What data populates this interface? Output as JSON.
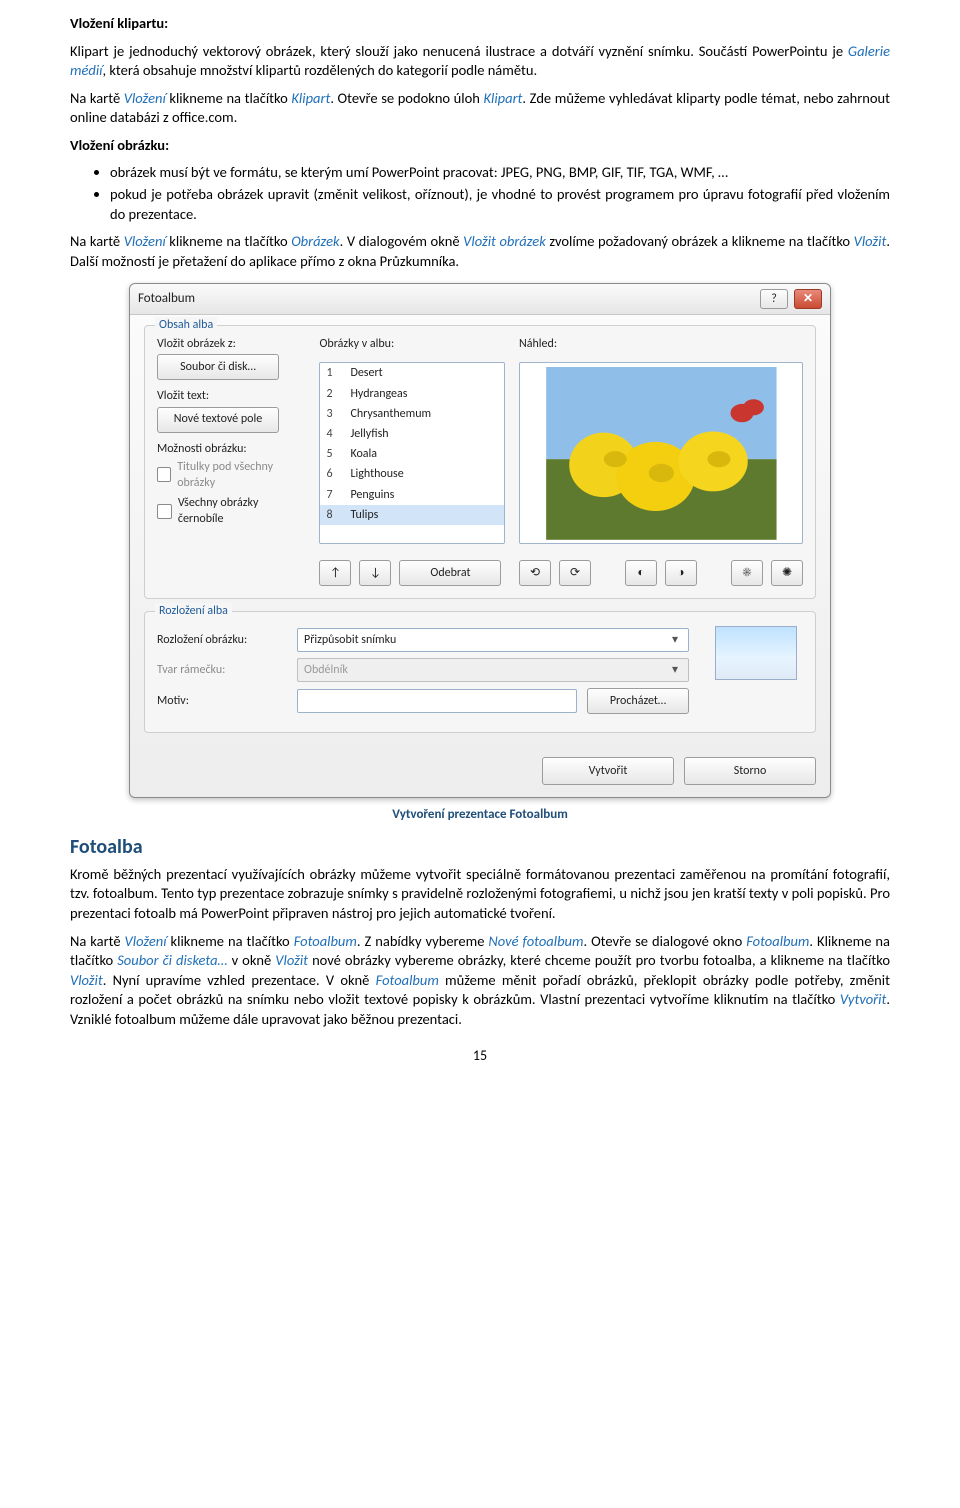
{
  "doc": {
    "h_klipart": "Vložení klipartu:",
    "p1a": "Klipart je jednoduchý vektorový obrázek, který slouží jako nenucená ilustrace a dotváří vyznění snímku. Součástí PowerPointu je ",
    "p1_link1": "Galerie médií",
    "p1b": ", která obsahuje množství klipartů rozdělených do kategorií podle námětu.",
    "p2a": "Na kartě ",
    "p2_link1": "Vložení",
    "p2b": " klikneme na tlačítko ",
    "p2_link2": "Klipart",
    "p2c": ". Otevře se podokno úloh ",
    "p2_link3": "Klipart",
    "p2d": ". Zde můžeme vyhledávat kliparty podle témat, nebo zahrnout online databázi z office.com.",
    "h_obrazek": "Vložení obrázku:",
    "li1": "obrázek musí být ve formátu, se kterým umí PowerPoint pracovat: JPEG, PNG, BMP, GIF, TIF, TGA, WMF, …",
    "li2": "pokud je potřeba obrázek upravit (změnit velikost, oříznout), je vhodné to provést programem pro úpravu fotografií před vložením do prezentace.",
    "p3a": "Na kartě ",
    "p3_link1": "Vložení",
    "p3b": " klikneme na tlačítko ",
    "p3_link2": "Obrázek",
    "p3c": ". V dialogovém okně ",
    "p3_link3": "Vložit obrázek",
    "p3d": " zvolíme požadovaný obrázek a klikneme na tlačítko ",
    "p3_link4": "Vložit",
    "p3e": ". Další možností je přetažení do aplikace přímo z okna Průzkumníka.",
    "caption": "Vytvoření prezentace Fotoalbum",
    "h2_fotoalba": "Fotoalba",
    "p4": "Kromě běžných prezentací využívajících obrázky můžeme vytvořit speciálně formátovanou prezentaci zaměřenou na promítání fotografií, tzv. fotoalbum. Tento typ prezentace zobrazuje snímky s pravidelně rozloženými fotografiemi, u nichž jsou jen kratší texty v poli popisků. Pro prezentaci fotoalb má PowerPoint připraven nástroj pro jejich automatické tvoření.",
    "p5a": "Na kartě ",
    "p5_link1": "Vložení",
    "p5b": " klikneme na tlačítko ",
    "p5_link2": "Fotoalbum",
    "p5c": ". Z nabídky vybereme ",
    "p5_link3": "Nové fotoalbum",
    "p5d": ". Otevře se dialogové okno ",
    "p5_link4": "Fotoalbum",
    "p5e": ". Klikneme na tlačítko ",
    "p5_link5": "Soubor či disketa…",
    "p5f": " v okně ",
    "p5_link6": "Vložit",
    "p5g": " nové obrázky vybereme obrázky, které chceme použít pro tvorbu fotoalba, a klikneme na tlačítko ",
    "p5_link7": "Vložit",
    "p5h": ". Nyní upravíme vzhled prezentace. V okně ",
    "p5_link8": "Fotoalbum",
    "p5i": " můžeme měnit pořadí obrázků, překlopit obrázky podle potřeby, změnit rozložení a počet obrázků na snímku nebo vložit textové popisky k obrázkům. Vlastní prezentaci vytvoříme kliknutím na tlačítko ",
    "p5_link9": "Vytvořit",
    "p5j": ". Vzniklé fotoalbum můžeme dále upravovat jako běžnou prezentaci.",
    "pagenum": "15"
  },
  "dlg": {
    "title": "Fotoalbum",
    "group_obsah": "Obsah alba",
    "lbl_vlozit_obrazek": "Vložit obrázek z:",
    "btn_soubor": "Soubor či disk…",
    "lbl_vlozit_text": "Vložit text:",
    "btn_textpole": "Nové textové pole",
    "lbl_moznosti": "Možnosti obrázku:",
    "chk_titulky": "Titulky pod všechny obrázky",
    "chk_cb": "Všechny obrázky černobíle",
    "lbl_obrazky_v_albu": "Obrázky v albu:",
    "list": [
      {
        "n": "1",
        "name": "Desert"
      },
      {
        "n": "2",
        "name": "Hydrangeas"
      },
      {
        "n": "3",
        "name": "Chrysanthemum"
      },
      {
        "n": "4",
        "name": "Jellyfish"
      },
      {
        "n": "5",
        "name": "Koala"
      },
      {
        "n": "6",
        "name": "Lighthouse"
      },
      {
        "n": "7",
        "name": "Penguins"
      },
      {
        "n": "8",
        "name": "Tulips"
      }
    ],
    "lbl_nahled": "Náhled:",
    "btn_odebrat": "Odebrat",
    "group_rozlozeni": "Rozložení alba",
    "lbl_rozlozeni": "Rozložení obrázku:",
    "combo_rozlozeni": "Přizpůsobit snímku",
    "lbl_tvar": "Tvar rámečku:",
    "combo_tvar": "Obdélník",
    "lbl_motiv": "Motiv:",
    "btn_prochazet": "Procházet…",
    "btn_vytvorit": "Vytvořit",
    "btn_storno": "Storno"
  }
}
